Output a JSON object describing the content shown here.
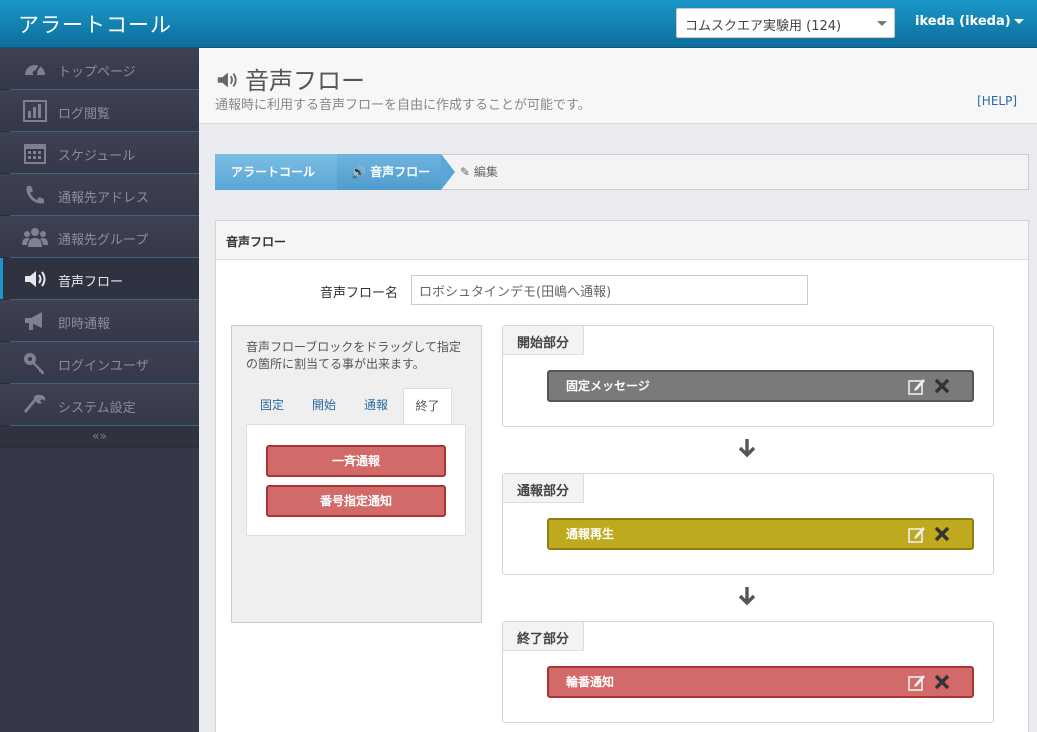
{
  "header": {
    "brand": "アラートコール",
    "org_select": "コムスクエア実験用 (124)",
    "user": "ikeda (ikeda)"
  },
  "sidebar": {
    "items": [
      {
        "label": "トップページ",
        "icon": "dashboard-icon"
      },
      {
        "label": "ログ閲覧",
        "icon": "bar-chart-icon"
      },
      {
        "label": "スケジュール",
        "icon": "calendar-icon"
      },
      {
        "label": "通報先アドレス",
        "icon": "phone-icon"
      },
      {
        "label": "通報先グループ",
        "icon": "group-icon"
      },
      {
        "label": "音声フロー",
        "icon": "speaker-icon"
      },
      {
        "label": "即時通報",
        "icon": "megaphone-icon"
      },
      {
        "label": "ログインユーザ",
        "icon": "key-icon"
      },
      {
        "label": "システム設定",
        "icon": "wrench-icon"
      }
    ],
    "collapse_label": "«»"
  },
  "page": {
    "title": "音声フロー",
    "description": "通報時に利用する音声フローを自由に作成することが可能です。",
    "help": "[HELP]"
  },
  "breadcrumb": [
    "アラートコール",
    "音声フロー",
    "編集"
  ],
  "panel": {
    "title": "音声フロー",
    "flow_name_label": "音声フロー名",
    "flow_name_value": "ロボシュタインデモ(田嶋へ通報)"
  },
  "palette": {
    "hint": "音声フローブロックをドラッグして指定の箇所に割当てる事が出来ます。",
    "tabs": [
      "固定",
      "開始",
      "通報",
      "終了"
    ],
    "active_tab": "終了",
    "blocks": [
      "一斉通報",
      "番号指定通知"
    ]
  },
  "sections": [
    {
      "label": "開始部分",
      "block": "固定メッセージ",
      "color": "#7a7a7a"
    },
    {
      "label": "通報部分",
      "block": "通報再生",
      "color": "#bfa91e"
    },
    {
      "label": "終了部分",
      "block": "輪番通知",
      "color": "#d26a6a"
    }
  ],
  "colors": {
    "header": "#1a97c8",
    "sidebar": "#353848",
    "accent": "#4f9ccf"
  }
}
